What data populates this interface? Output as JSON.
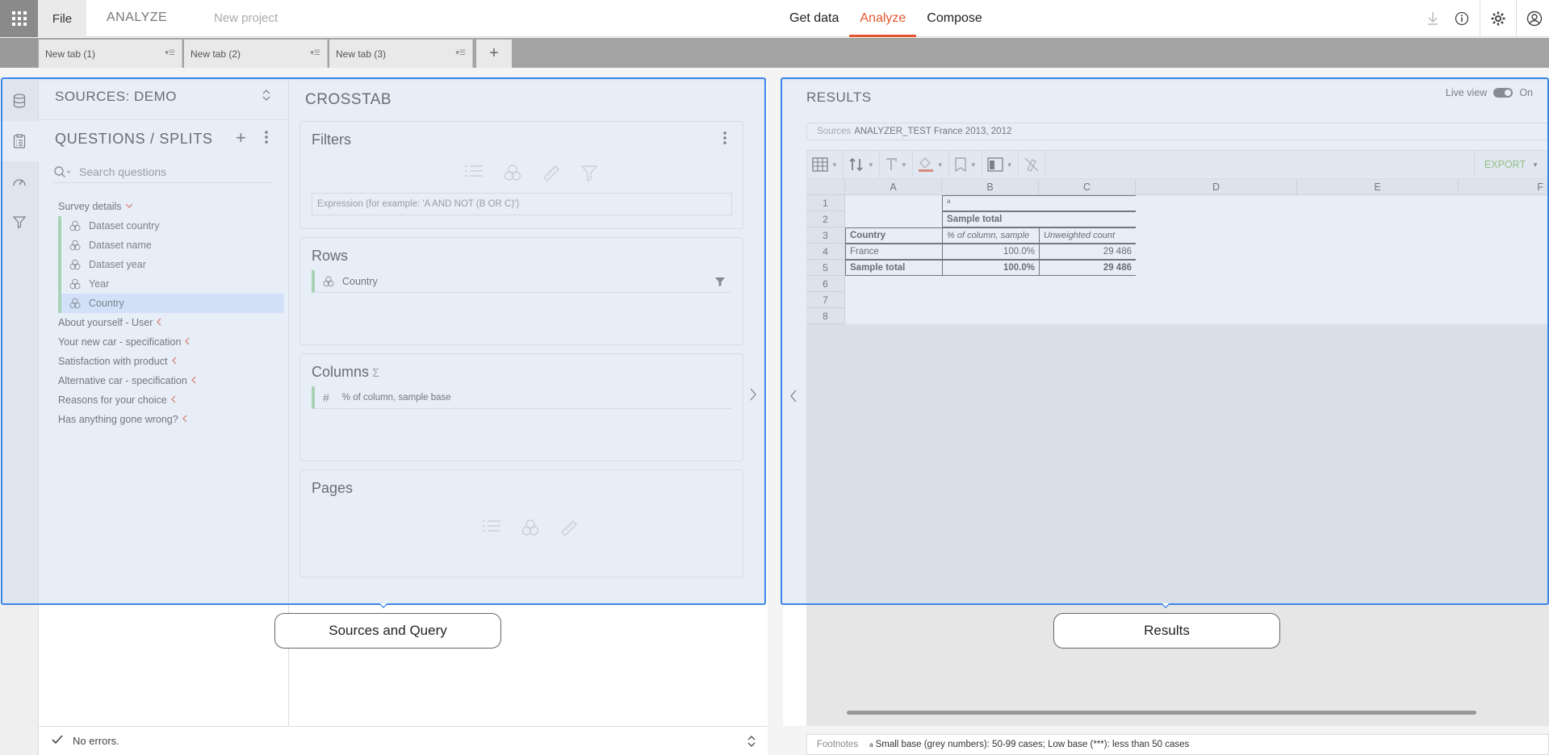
{
  "topbar": {
    "file_label": "File",
    "mode_label": "ANALYZE",
    "project_name": "New project",
    "nav": [
      {
        "label": "Get data"
      },
      {
        "label": "Analyze"
      },
      {
        "label": "Compose"
      }
    ],
    "active_nav": "Analyze"
  },
  "tabs": [
    {
      "label": "New tab (1)"
    },
    {
      "label": "New tab (2)"
    },
    {
      "label": "New tab (3)"
    }
  ],
  "add_tab_label": "+",
  "sources_panel": {
    "title": "SOURCES: DEMO"
  },
  "questions_panel": {
    "title": "QUESTIONS / SPLITS",
    "add_label": "+",
    "search_placeholder": "Search questions",
    "groups": [
      {
        "label": "Survey details",
        "expanded": true,
        "children": [
          {
            "label": "Dataset country"
          },
          {
            "label": "Dataset name"
          },
          {
            "label": "Dataset year"
          },
          {
            "label": "Year"
          },
          {
            "label": "Country"
          }
        ]
      },
      {
        "label": "About yourself - User"
      },
      {
        "label": "Your new car - specification"
      },
      {
        "label": "Satisfaction with product"
      },
      {
        "label": "Alternative car - specification"
      },
      {
        "label": "Reasons for your choice"
      },
      {
        "label": "Has anything gone wrong?"
      }
    ],
    "selected": "Country"
  },
  "crosstab": {
    "title": "CROSSTAB",
    "filters": {
      "title": "Filters",
      "expression_placeholder": "Expression (for example: 'A AND NOT (B OR C)')"
    },
    "rows": {
      "title": "Rows",
      "field": "Country"
    },
    "columns": {
      "title": "Columns",
      "sigma": "Σ",
      "hash": "#",
      "field": "% of column, sample base"
    },
    "pages": {
      "title": "Pages"
    }
  },
  "status": {
    "text": "No errors."
  },
  "results": {
    "title": "RESULTS",
    "live_view_label": "Live view",
    "live_view_state": "On",
    "sources_label": "Sources",
    "sources_value": "ANALYZER_TEST France 2013, 2012",
    "export_label": "EXPORT",
    "columns": [
      "A",
      "B",
      "C",
      "D",
      "E",
      "F"
    ],
    "row_numbers": [
      "1",
      "2",
      "3",
      "4",
      "5",
      "6",
      "7",
      "8"
    ],
    "table": {
      "r1": {
        "b": "a"
      },
      "r2": {
        "b": "Sample total"
      },
      "r3": {
        "a": "Country",
        "b": "% of column, sample",
        "c": "Unweighted count"
      },
      "r4": {
        "a": "France",
        "b": "100.0%",
        "c": "29 486"
      },
      "r5": {
        "a": "Sample total",
        "b": "100.0%",
        "c": "29 486"
      }
    },
    "footnotes_label": "Footnotes",
    "footnote_marker": "a",
    "footnote_text": "Small base (grey numbers): 50-99 cases; Low base (***): less than 50 cases"
  },
  "callouts": {
    "left": "Sources and Query",
    "right": "Results"
  },
  "colors": {
    "accent": "#e4572e",
    "overlay_border": "#3c86e8",
    "tree_bar": "#8fd18b",
    "export": "#6bab3a"
  }
}
